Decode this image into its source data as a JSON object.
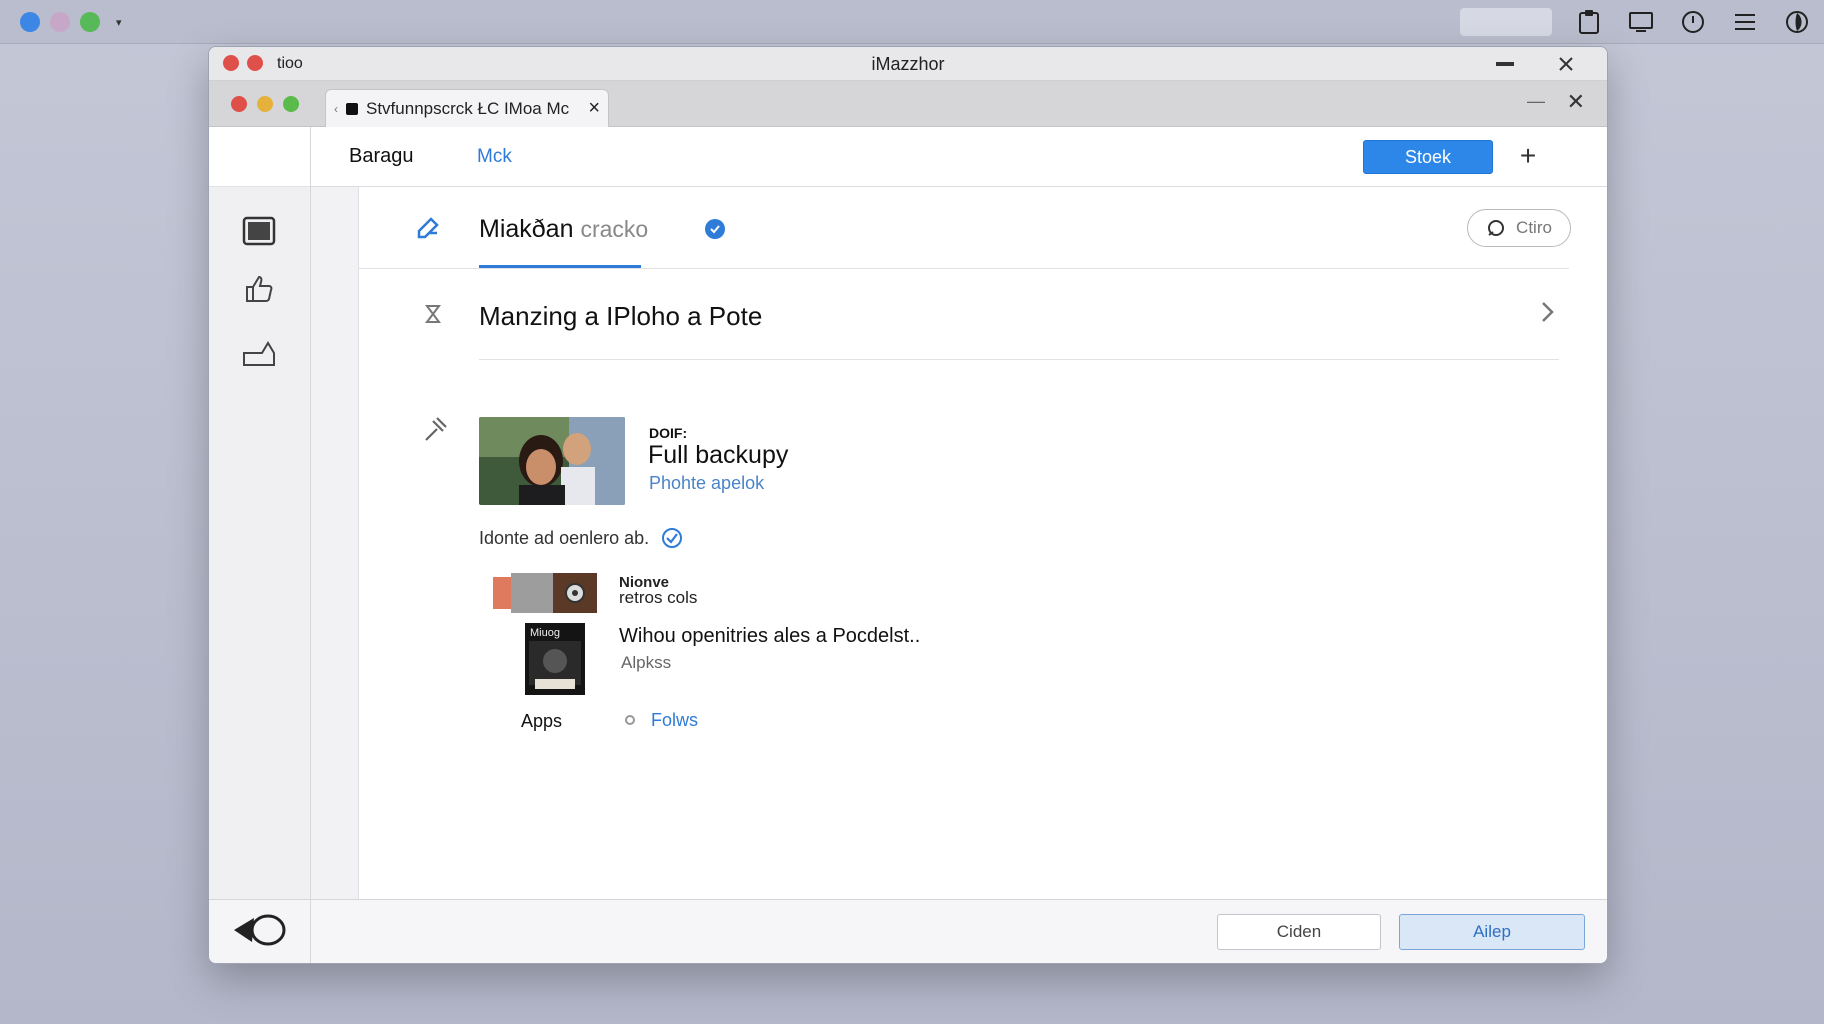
{
  "window": {
    "app_label": "tioo",
    "title": "iMazzhor"
  },
  "tab": {
    "label": "Stvfunnpscrck  ŁC  IMoa Mc"
  },
  "header": {
    "title": "Baragu",
    "link": "Mck",
    "primary_button": "Stoek",
    "add_symbol": "+"
  },
  "section": {
    "title_main": "Miakðan",
    "title_muted": "cracko",
    "pill_label": "Ctiro"
  },
  "row1": {
    "text": "Manzing a IPloho a Pote"
  },
  "card": {
    "kicker": "DOIF:",
    "title": "Full backupy",
    "subtitle": "Phohte apelok"
  },
  "status": {
    "text": "Idonte ad oenlero ab."
  },
  "item1": {
    "line1": "Nionve",
    "line2": "retros cols"
  },
  "item2": {
    "thumb_label": "Miuog",
    "title": "Wihou openitries ales a Pocdelst..",
    "subtitle": "Alpkss"
  },
  "apps": {
    "label": "Apps",
    "link": "Folws"
  },
  "footer": {
    "secondary_button": "Ciden",
    "primary_button": "Ailep"
  },
  "colors": {
    "accent": "#2d87e8",
    "link": "#2f7bd8",
    "close_red": "#e0504a",
    "min_yellow": "#e4b13a",
    "max_green": "#5bbb4a"
  },
  "icons": {
    "sidebar": [
      "window-icon",
      "thumbs-up-icon",
      "tray-icon"
    ],
    "footer_sidebar": "speech-bubble-icon"
  }
}
